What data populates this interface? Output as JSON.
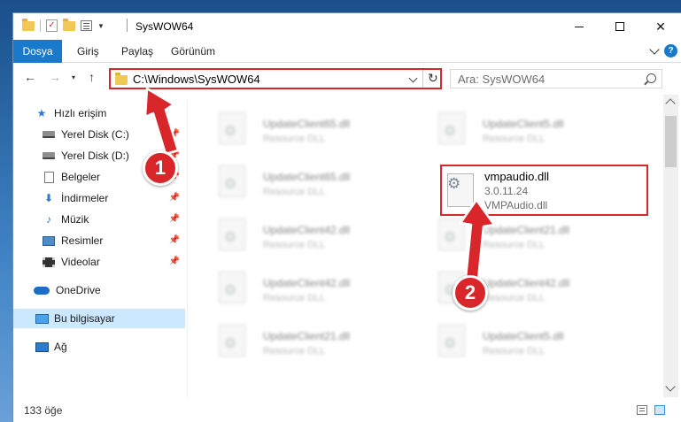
{
  "window": {
    "title": "SysWOW64"
  },
  "window_controls": {
    "minimize": "minimize",
    "maximize": "maximize",
    "close": "✕"
  },
  "ribbon": {
    "tabs": [
      {
        "label": "Dosya"
      },
      {
        "label": "Giriş"
      },
      {
        "label": "Paylaş"
      },
      {
        "label": "Görünüm"
      }
    ],
    "help": "?"
  },
  "nav": {
    "back": "←",
    "forward": "→",
    "recent_dropdown": "▾",
    "up": "↑",
    "address": "C:\\Windows\\SysWOW64",
    "refresh": "↻",
    "search_placeholder": "Ara: SysWOW64"
  },
  "sidebar": {
    "items": [
      {
        "label": "Hızlı erişim",
        "icon": "star-icon",
        "pinned": false
      },
      {
        "label": "Yerel Disk (C:)",
        "icon": "drive-icon",
        "pinned": true
      },
      {
        "label": "Yerel Disk (D:)",
        "icon": "drive-icon",
        "pinned": true
      },
      {
        "label": "Belgeler",
        "icon": "documents-icon",
        "pinned": true
      },
      {
        "label": "İndirmeler",
        "icon": "download-icon",
        "pinned": true
      },
      {
        "label": "Müzik",
        "icon": "music-icon",
        "pinned": true
      },
      {
        "label": "Resimler",
        "icon": "pictures-icon",
        "pinned": true
      },
      {
        "label": "Videolar",
        "icon": "videos-icon",
        "pinned": true
      },
      {
        "label": "OneDrive",
        "icon": "cloud-icon",
        "pinned": false
      },
      {
        "label": "Bu bilgisayar",
        "icon": "computer-icon",
        "pinned": false,
        "selected": true
      },
      {
        "label": "Ağ",
        "icon": "network-icon",
        "pinned": false
      }
    ]
  },
  "files": {
    "blurred": [
      {
        "name": "UpdateClient65.dll",
        "desc": "Resource DLL"
      },
      {
        "name": "UpdateClient5.dll",
        "desc": "Resource DLL"
      },
      {
        "name": "UpdateClient65.dll",
        "desc": "Resource DLL"
      },
      {
        "name": "UpdateClient42.dll",
        "desc": "Resource DLL"
      },
      {
        "name": "UpdateClient21.dll",
        "desc": "Resource DLL"
      },
      {
        "name": "UpdateClient42.dll",
        "desc": "Resource DLL"
      },
      {
        "name": "UpdateClient42.dll",
        "desc": "Resource DLL"
      },
      {
        "name": "UpdateClient21.dll",
        "desc": "Resource DLL"
      },
      {
        "name": "UpdateClient5.dll",
        "desc": "Resource DLL"
      }
    ],
    "highlighted": {
      "name": "vmpaudio.dll",
      "version": "3.0.11.24",
      "desc": "VMPAudio.dll"
    }
  },
  "status": {
    "item_count": "133 öğe"
  },
  "annotations": {
    "step1": "1",
    "step2": "2"
  },
  "colors": {
    "accent": "#1979ca",
    "highlight_red": "#d9262a",
    "selection": "#cce8ff"
  }
}
